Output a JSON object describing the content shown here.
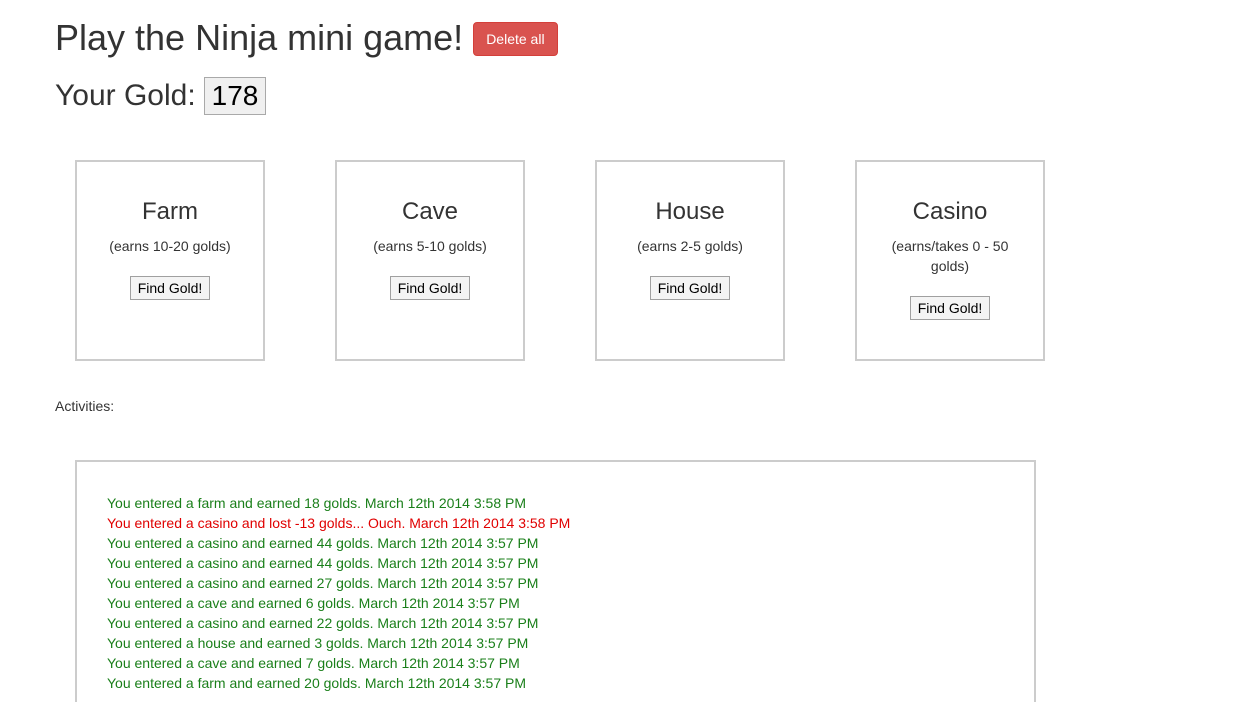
{
  "header": {
    "title": "Play the Ninja mini game!",
    "delete_label": "Delete all"
  },
  "gold": {
    "label": "Your Gold:",
    "value": "178"
  },
  "buildings": [
    {
      "name": "Farm",
      "desc": "(earns 10-20 golds)",
      "button": "Find Gold!"
    },
    {
      "name": "Cave",
      "desc": "(earns 5-10 golds)",
      "button": "Find Gold!"
    },
    {
      "name": "House",
      "desc": "(earns 2-5 golds)",
      "button": "Find Gold!"
    },
    {
      "name": "Casino",
      "desc": "(earns/takes 0 - 50 golds)",
      "button": "Find Gold!"
    }
  ],
  "activities": {
    "label": "Activities:",
    "entries": [
      {
        "text": "You entered a farm and earned 18 golds. March 12th 2014 3:58 PM",
        "type": "earn"
      },
      {
        "text": "You entered a casino and lost -13 golds... Ouch. March 12th 2014 3:58 PM",
        "type": "loss"
      },
      {
        "text": "You entered a casino and earned 44 golds. March 12th 2014 3:57 PM",
        "type": "earn"
      },
      {
        "text": "You entered a casino and earned 44 golds. March 12th 2014 3:57 PM",
        "type": "earn"
      },
      {
        "text": "You entered a casino and earned 27 golds. March 12th 2014 3:57 PM",
        "type": "earn"
      },
      {
        "text": "You entered a cave and earned 6 golds. March 12th 2014 3:57 PM",
        "type": "earn"
      },
      {
        "text": "You entered a casino and earned 22 golds. March 12th 2014 3:57 PM",
        "type": "earn"
      },
      {
        "text": "You entered a house and earned 3 golds. March 12th 2014 3:57 PM",
        "type": "earn"
      },
      {
        "text": "You entered a cave and earned 7 golds. March 12th 2014 3:57 PM",
        "type": "earn"
      },
      {
        "text": "You entered a farm and earned 20 golds. March 12th 2014 3:57 PM",
        "type": "earn"
      }
    ]
  },
  "colors": {
    "earn": "#1a7f1a",
    "loss": "#e00000",
    "delete_button": "#d9534f"
  }
}
